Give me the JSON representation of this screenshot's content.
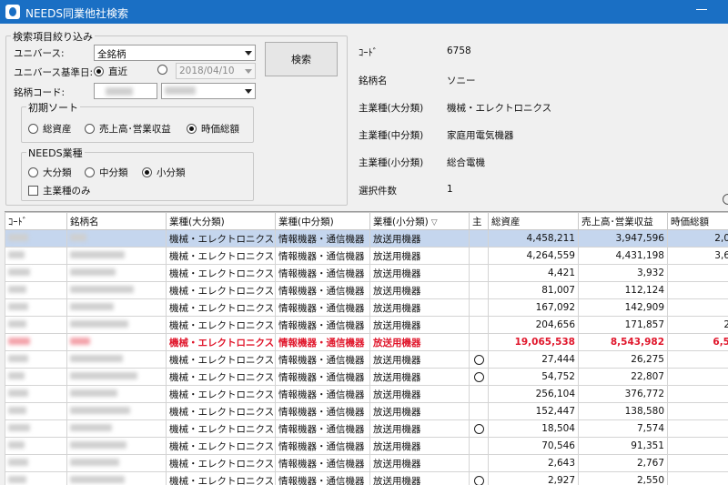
{
  "window": {
    "title": "NEEDS同業他社検索",
    "accent": "#1a6fc4"
  },
  "filter": {
    "group_title": "検索項目絞り込み",
    "universe_label": "ユニバース:",
    "universe_value": "全銘柄",
    "base_date_label": "ユニバース基準日:",
    "base_date_recent": "直近",
    "base_date_value": "2018/04/10",
    "code_label": "銘柄コード:",
    "search_button": "検索",
    "sort_group_title": "初期ソート",
    "sort_options": [
      "総資産",
      "売上高･営業収益",
      "時価総額"
    ],
    "sort_selected": "時価総額",
    "industry_group_title": "NEEDS業種",
    "industry_options": [
      "大分類",
      "中分類",
      "小分類"
    ],
    "industry_selected": "小分類",
    "main_industry_only": "主業種のみ"
  },
  "info": {
    "code_label": "ｺｰﾄﾞ",
    "code_value": "6758",
    "name_label": "銘柄名",
    "name_value": "ソニー",
    "major_label": "主業種(大分類)",
    "major_value": "機械・エレクトロニクス",
    "mid_label": "主業種(中分類)",
    "mid_value": "家庭用電気機器",
    "minor_label": "主業種(小分類)",
    "minor_value": "総合電機",
    "count_label": "選択件数",
    "count_value": "1"
  },
  "table": {
    "columns": [
      "ｺｰﾄﾞ",
      "銘柄名",
      "業種(大分類)",
      "業種(中分類)",
      "業種(小分類)",
      "主",
      "総資産",
      "売上高･営業収益",
      "時価総額"
    ],
    "sorted_column_indicator": "▽",
    "highlight_color": "#e0162b",
    "selected_color": "#c5d6ee",
    "rows": [
      {
        "major": "機械・エレクトロニクス",
        "mid": "情報機器・通信機器",
        "minor": "放送用機器",
        "main": "",
        "assets": "4,458,211",
        "sales": "3,947,596",
        "mcap": "2,0",
        "state": "selected"
      },
      {
        "major": "機械・エレクトロニクス",
        "mid": "情報機器・通信機器",
        "minor": "放送用機器",
        "main": "",
        "assets": "4,264,559",
        "sales": "4,431,198",
        "mcap": "3,6",
        "state": ""
      },
      {
        "major": "機械・エレクトロニクス",
        "mid": "情報機器・通信機器",
        "minor": "放送用機器",
        "main": "",
        "assets": "4,421",
        "sales": "3,932",
        "mcap": "",
        "state": ""
      },
      {
        "major": "機械・エレクトロニクス",
        "mid": "情報機器・通信機器",
        "minor": "放送用機器",
        "main": "",
        "assets": "81,007",
        "sales": "112,124",
        "mcap": "",
        "state": ""
      },
      {
        "major": "機械・エレクトロニクス",
        "mid": "情報機器・通信機器",
        "minor": "放送用機器",
        "main": "",
        "assets": "167,092",
        "sales": "142,909",
        "mcap": "",
        "state": ""
      },
      {
        "major": "機械・エレクトロニクス",
        "mid": "情報機器・通信機器",
        "minor": "放送用機器",
        "main": "",
        "assets": "204,656",
        "sales": "171,857",
        "mcap": "2",
        "state": ""
      },
      {
        "major": "機械・エレクトロニクス",
        "mid": "情報機器・通信機器",
        "minor": "放送用機器",
        "main": "",
        "assets": "19,065,538",
        "sales": "8,543,982",
        "mcap": "6,5",
        "state": "highlight"
      },
      {
        "major": "機械・エレクトロニクス",
        "mid": "情報機器・通信機器",
        "minor": "放送用機器",
        "main": "○",
        "assets": "27,444",
        "sales": "26,275",
        "mcap": "",
        "state": ""
      },
      {
        "major": "機械・エレクトロニクス",
        "mid": "情報機器・通信機器",
        "minor": "放送用機器",
        "main": "○",
        "assets": "54,752",
        "sales": "22,807",
        "mcap": "",
        "state": ""
      },
      {
        "major": "機械・エレクトロニクス",
        "mid": "情報機器・通信機器",
        "minor": "放送用機器",
        "main": "",
        "assets": "256,104",
        "sales": "376,772",
        "mcap": "",
        "state": ""
      },
      {
        "major": "機械・エレクトロニクス",
        "mid": "情報機器・通信機器",
        "minor": "放送用機器",
        "main": "",
        "assets": "152,447",
        "sales": "138,580",
        "mcap": "",
        "state": ""
      },
      {
        "major": "機械・エレクトロニクス",
        "mid": "情報機器・通信機器",
        "minor": "放送用機器",
        "main": "○",
        "assets": "18,504",
        "sales": "7,574",
        "mcap": "",
        "state": ""
      },
      {
        "major": "機械・エレクトロニクス",
        "mid": "情報機器・通信機器",
        "minor": "放送用機器",
        "main": "",
        "assets": "70,546",
        "sales": "91,351",
        "mcap": "",
        "state": ""
      },
      {
        "major": "機械・エレクトロニクス",
        "mid": "情報機器・通信機器",
        "minor": "放送用機器",
        "main": "",
        "assets": "2,643",
        "sales": "2,767",
        "mcap": "",
        "state": ""
      },
      {
        "major": "機械・エレクトロニクス",
        "mid": "情報機器・通信機器",
        "minor": "放送用機器",
        "main": "○",
        "assets": "2,927",
        "sales": "2,550",
        "mcap": "",
        "state": ""
      }
    ]
  }
}
